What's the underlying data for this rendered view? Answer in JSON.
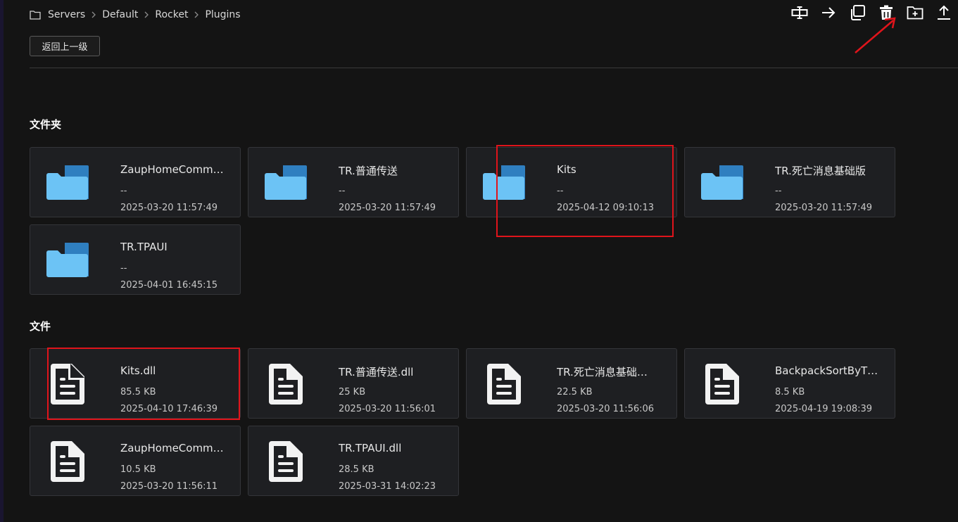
{
  "breadcrumb": {
    "items": [
      "Servers",
      "Default",
      "Rocket",
      "Plugins"
    ]
  },
  "toolbar": {
    "icons": [
      "rename-icon",
      "move-icon",
      "copy-icon",
      "delete-icon",
      "new-folder-icon",
      "upload-icon"
    ]
  },
  "back_button": {
    "label": "返回上一级"
  },
  "sections": {
    "folders_title": "文件夹",
    "files_title": "文件"
  },
  "folders": [
    {
      "name": "ZaupHomeComm…",
      "size": "--",
      "date": "2025-03-20 11:57:49"
    },
    {
      "name": "TR.普通传送",
      "size": "--",
      "date": "2025-03-20 11:57:49"
    },
    {
      "name": "Kits",
      "size": "--",
      "date": "2025-04-12 09:10:13"
    },
    {
      "name": "TR.死亡消息基础版",
      "size": "--",
      "date": "2025-03-20 11:57:49"
    },
    {
      "name": "TR.TPAUI",
      "size": "--",
      "date": "2025-04-01 16:45:15"
    }
  ],
  "files": [
    {
      "name": "Kits.dll",
      "size": "85.5 KB",
      "date": "2025-04-10 17:46:39"
    },
    {
      "name": "TR.普通传送.dll",
      "size": "25 KB",
      "date": "2025-03-20 11:56:01"
    },
    {
      "name": "TR.死亡消息基础…",
      "size": "22.5 KB",
      "date": "2025-03-20 11:56:06"
    },
    {
      "name": "BackpackSortByT…",
      "size": "8.5 KB",
      "date": "2025-04-19 19:08:39"
    },
    {
      "name": "ZaupHomeComm…",
      "size": "10.5 KB",
      "date": "2025-03-20 11:56:11"
    },
    {
      "name": "TR.TPAUI.dll",
      "size": "28.5 KB",
      "date": "2025-03-31 14:02:23"
    }
  ],
  "colors": {
    "background": "#141414",
    "card": "#1e1f22",
    "folder_light": "#6cc3f5",
    "folder_dark": "#2f7fc0",
    "annotation": "#e0141b"
  }
}
